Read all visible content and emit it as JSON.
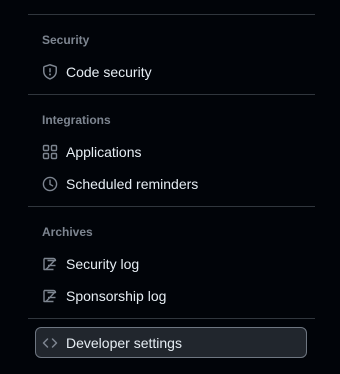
{
  "sections": [
    {
      "heading": "Security",
      "items": [
        {
          "label": "Code security",
          "icon": "shield-icon"
        }
      ]
    },
    {
      "heading": "Integrations",
      "items": [
        {
          "label": "Applications",
          "icon": "apps-grid-icon"
        },
        {
          "label": "Scheduled reminders",
          "icon": "clock-icon"
        }
      ]
    },
    {
      "heading": "Archives",
      "items": [
        {
          "label": "Security log",
          "icon": "log-icon"
        },
        {
          "label": "Sponsorship log",
          "icon": "log-icon"
        }
      ]
    }
  ],
  "footer_item": {
    "label": "Developer settings",
    "icon": "code-icon"
  },
  "colors": {
    "background": "#010409",
    "text": "#e6edf3",
    "muted": "#7d8590",
    "divider": "#30363d",
    "selected_bg": "#21262d",
    "selected_border": "#6e7681"
  }
}
